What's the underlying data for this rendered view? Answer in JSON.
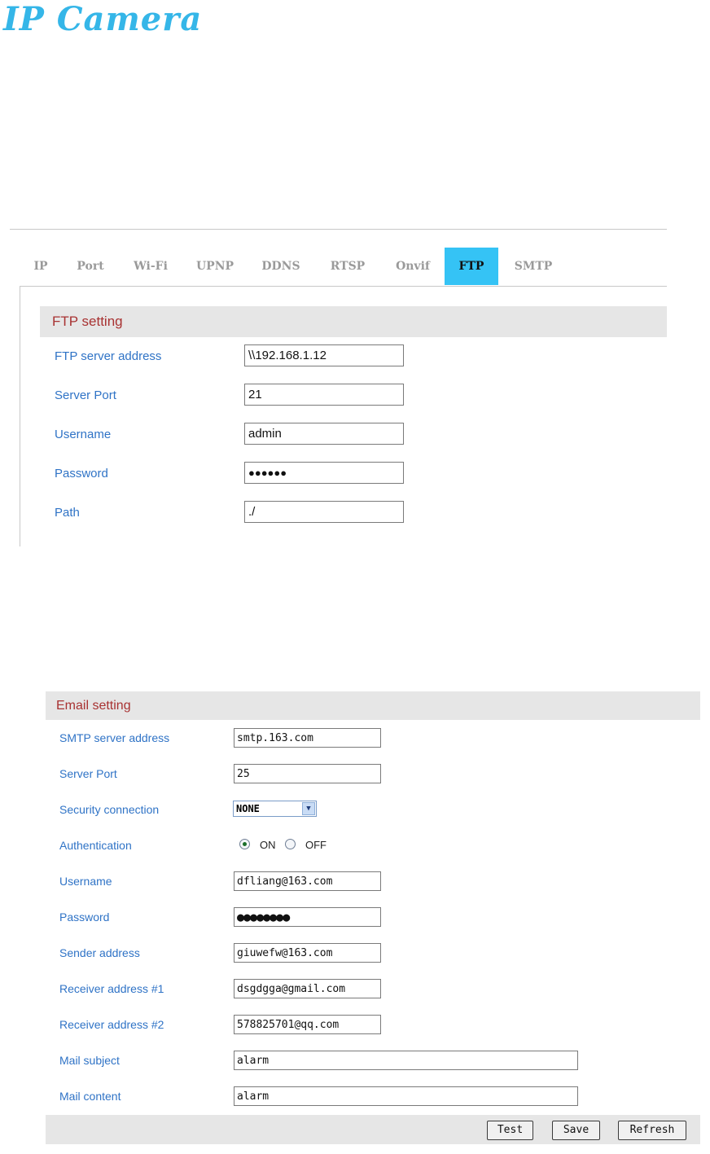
{
  "logo": "IP Camera",
  "ftp_panel": {
    "tabs": [
      {
        "label": "IP"
      },
      {
        "label": "Port"
      },
      {
        "label": "Wi-Fi"
      },
      {
        "label": "UPNP"
      },
      {
        "label": "DDNS"
      },
      {
        "label": "RTSP"
      },
      {
        "label": "Onvif"
      },
      {
        "label": "FTP",
        "active": true
      },
      {
        "label": "SMTP"
      }
    ],
    "section_title": "FTP setting",
    "fields": [
      {
        "label": "FTP server address",
        "value": "\\\\192.168.1.12"
      },
      {
        "label": "Server Port",
        "value": "21"
      },
      {
        "label": "Username",
        "value": "admin"
      },
      {
        "label": "Password",
        "value": "●●●●●●"
      },
      {
        "label": "Path",
        "value": "./"
      }
    ]
  },
  "email_panel": {
    "section_title": "Email setting",
    "fields": {
      "smtp_server": {
        "label": "SMTP server address",
        "value": "smtp.163.com"
      },
      "server_port": {
        "label": "Server Port",
        "value": "25"
      },
      "security": {
        "label": "Security connection",
        "value": "NONE"
      },
      "authentication": {
        "label": "Authentication",
        "on_label": "ON",
        "off_label": "OFF",
        "selected": "ON"
      },
      "username": {
        "label": "Username",
        "value": "dfliang@163.com"
      },
      "password": {
        "label": "Password",
        "value": "●●●●●●●●"
      },
      "sender": {
        "label": "Sender address",
        "value": "giuwefw@163.com"
      },
      "receiver1": {
        "label": "Receiver address #1",
        "value": "dsgdgga@gmail.com"
      },
      "receiver2": {
        "label": "Receiver address #2",
        "value": "578825701@qq.com"
      },
      "subject": {
        "label": "Mail subject",
        "value": "alarm"
      },
      "content": {
        "label": "Mail content",
        "value": "alarm"
      }
    },
    "buttons": {
      "test": "Test",
      "save": "Save",
      "refresh": "Refresh"
    }
  }
}
